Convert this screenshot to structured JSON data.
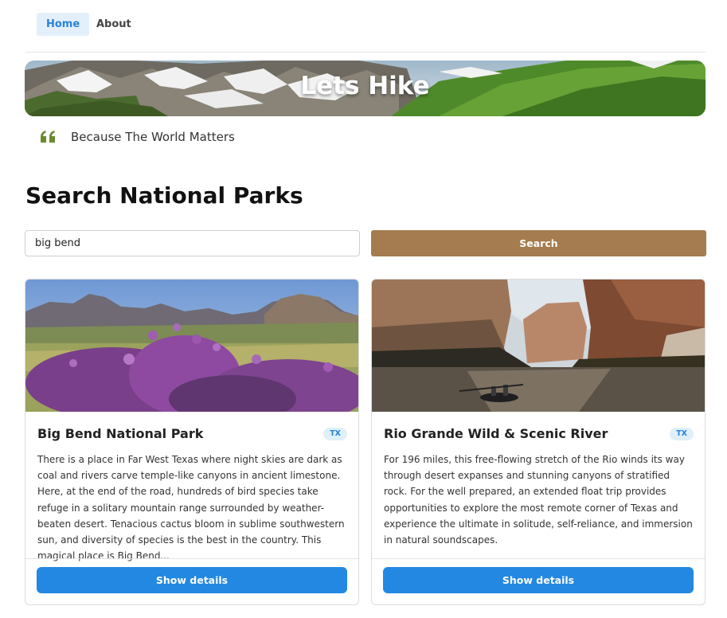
{
  "nav": {
    "items": [
      {
        "label": "Home",
        "active": true
      },
      {
        "label": "About",
        "active": false
      }
    ]
  },
  "hero": {
    "title": "Lets Hike"
  },
  "quote": {
    "text": "Because The World Matters",
    "icon": "quote-icon",
    "icon_color": "#6b8a2e"
  },
  "section_title": "Search National Parks",
  "search": {
    "value": "big bend",
    "button_label": "Search",
    "button_color": "#a57c4f"
  },
  "parks": [
    {
      "title": "Big Bend National Park",
      "state": "TX",
      "description": "There is a place in Far West Texas where night skies are dark as coal and rivers carve temple-like canyons in ancient limestone. Here, at the end of the road, hundreds of bird species take refuge in a solitary mountain range surrounded by weather-beaten desert. Tenacious cactus bloom in sublime southwestern sun, and diversity of species is the best in the country. This magical place is Big Bend...",
      "button_label": "Show details",
      "image": "desert-mountains-with-purple-flowers"
    },
    {
      "title": "Rio Grande Wild & Scenic River",
      "state": "TX",
      "description": "For 196 miles, this free-flowing stretch of the Rio winds its way through desert expanses and stunning canyons of stratified rock. For the well prepared, an extended float trip provides opportunities to explore the most remote corner of Texas and experience the ultimate in solitude, self-reliance, and immersion in natural soundscapes.",
      "button_label": "Show details",
      "image": "river-canyon-with-canoe"
    }
  ],
  "colors": {
    "accent_blue": "#2388e2",
    "nav_active_bg": "#e3f0fb"
  }
}
